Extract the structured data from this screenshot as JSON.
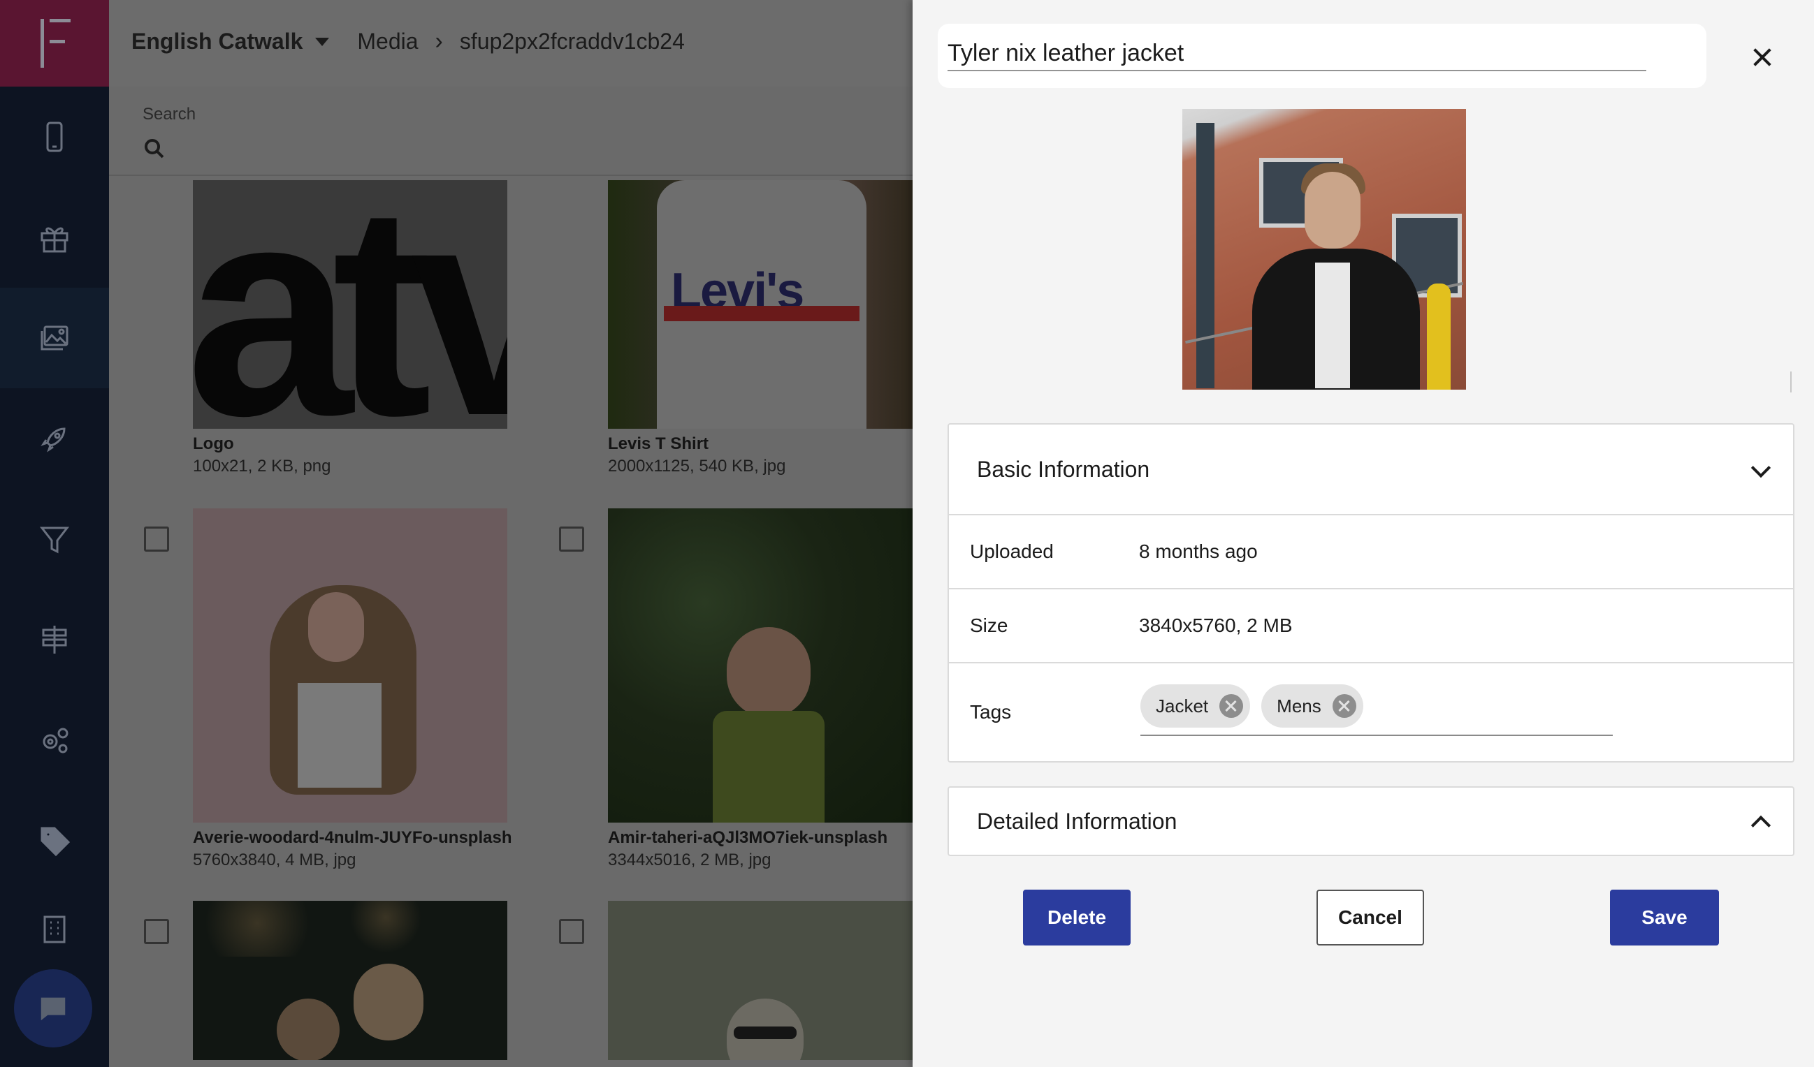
{
  "header": {
    "site_name": "English Catwalk",
    "breadcrumb_section": "Media",
    "breadcrumb_id": "sfup2px2fcraddv1cb24"
  },
  "search": {
    "label": "Search"
  },
  "nav": {
    "items": [
      "mobile-icon",
      "gift-icon",
      "images-icon",
      "rocket-icon",
      "filter-icon",
      "signpost-icon",
      "settings-icon",
      "tag-icon",
      "building-icon"
    ],
    "active": "images-icon"
  },
  "media": [
    {
      "name": "Logo",
      "meta": "100x21, 2 KB, png"
    },
    {
      "name": "Levis T Shirt",
      "meta": "2000x1125, 540 KB, jpg"
    },
    {
      "name": "Averie-woodard-4nulm-JUYFo-unsplash",
      "meta": "5760x3840, 4 MB, jpg"
    },
    {
      "name": "Amir-taheri-aQJl3MO7iek-unsplash",
      "meta": "3344x5016, 2 MB, jpg"
    }
  ],
  "drawer": {
    "title_value": "Tyler nix leather jacket",
    "basic_info": {
      "heading": "Basic Information",
      "uploaded_label": "Uploaded",
      "uploaded_value": "8 months ago",
      "size_label": "Size",
      "size_value": "3840x5760, 2 MB",
      "tags_label": "Tags",
      "tags": [
        "Jacket",
        "Mens"
      ]
    },
    "detailed_info": {
      "heading": "Detailed Information"
    },
    "buttons": {
      "delete": "Delete",
      "cancel": "Cancel",
      "save": "Save"
    }
  },
  "colors": {
    "rail_bg": "#0d1422",
    "brand_bg": "#5a1531",
    "primary": "#2b3c9e",
    "drawer_bg": "#f4f4f4"
  }
}
